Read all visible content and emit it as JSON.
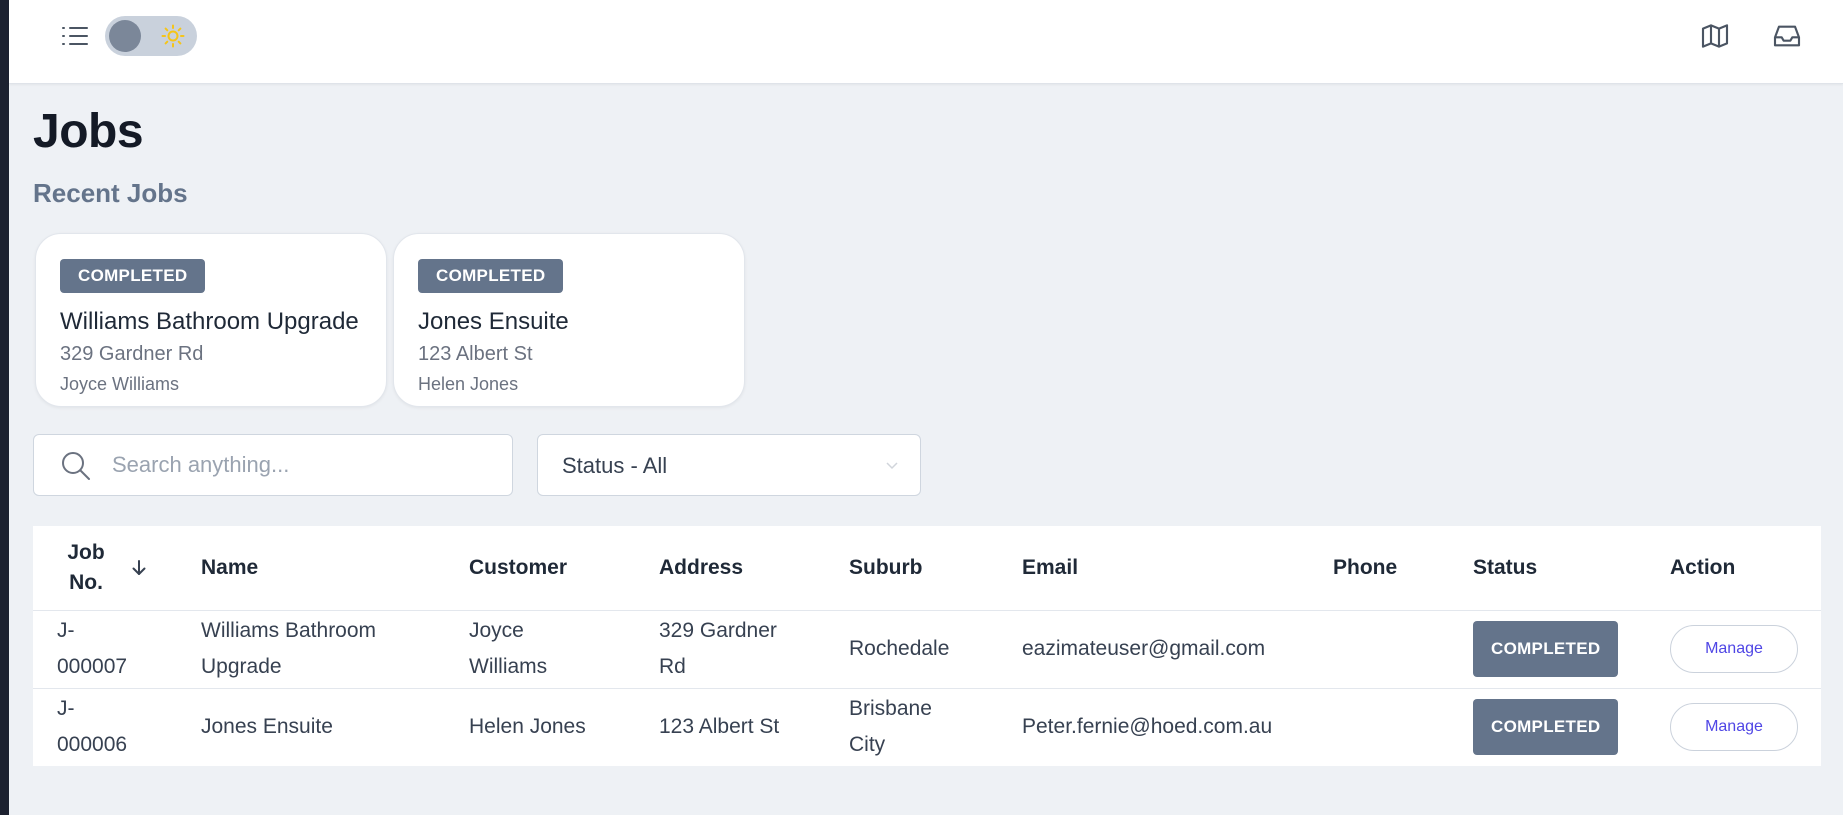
{
  "topbar": {
    "menu_icon": "list-menu-icon",
    "theme_toggle_icon": "sun-icon",
    "map_icon": "map-icon",
    "inbox_icon": "inbox-icon"
  },
  "page": {
    "title": "Jobs",
    "recent_title": "Recent Jobs"
  },
  "recent_jobs": [
    {
      "status": "COMPLETED",
      "name": "Williams Bathroom Upgrade",
      "address": "329 Gardner Rd",
      "customer": "Joyce Williams"
    },
    {
      "status": "COMPLETED",
      "name": "Jones Ensuite",
      "address": "123 Albert St",
      "customer": "Helen Jones"
    }
  ],
  "filters": {
    "search_placeholder": "Search anything...",
    "search_value": "",
    "status_value": "Status - All"
  },
  "table": {
    "headers": {
      "job_no_line1": "Job",
      "job_no_line2": "No.",
      "name": "Name",
      "customer": "Customer",
      "address": "Address",
      "suburb": "Suburb",
      "email": "Email",
      "phone": "Phone",
      "status": "Status",
      "action": "Action"
    },
    "rows": [
      {
        "job_no_line1": "J-",
        "job_no_line2": "000007",
        "name_line1": "Williams Bathroom",
        "name_line2": "Upgrade",
        "customer_line1": "Joyce",
        "customer_line2": "Williams",
        "address_line1": "329 Gardner",
        "address_line2": "Rd",
        "suburb": "Rochedale",
        "email": "eazimateuser@gmail.com",
        "phone": "",
        "status": "COMPLETED",
        "action": "Manage"
      },
      {
        "job_no_line1": "J-",
        "job_no_line2": "000006",
        "name": "Jones Ensuite",
        "customer": "Helen Jones",
        "address": "123 Albert St",
        "suburb_line1": "Brisbane",
        "suburb_line2": "City",
        "email": "Peter.fernie@hoed.com.au",
        "phone": "",
        "status": "COMPLETED",
        "action": "Manage"
      }
    ]
  },
  "colors": {
    "badge": "#64748b",
    "accent": "#4f46e5",
    "background": "#eef1f5"
  }
}
